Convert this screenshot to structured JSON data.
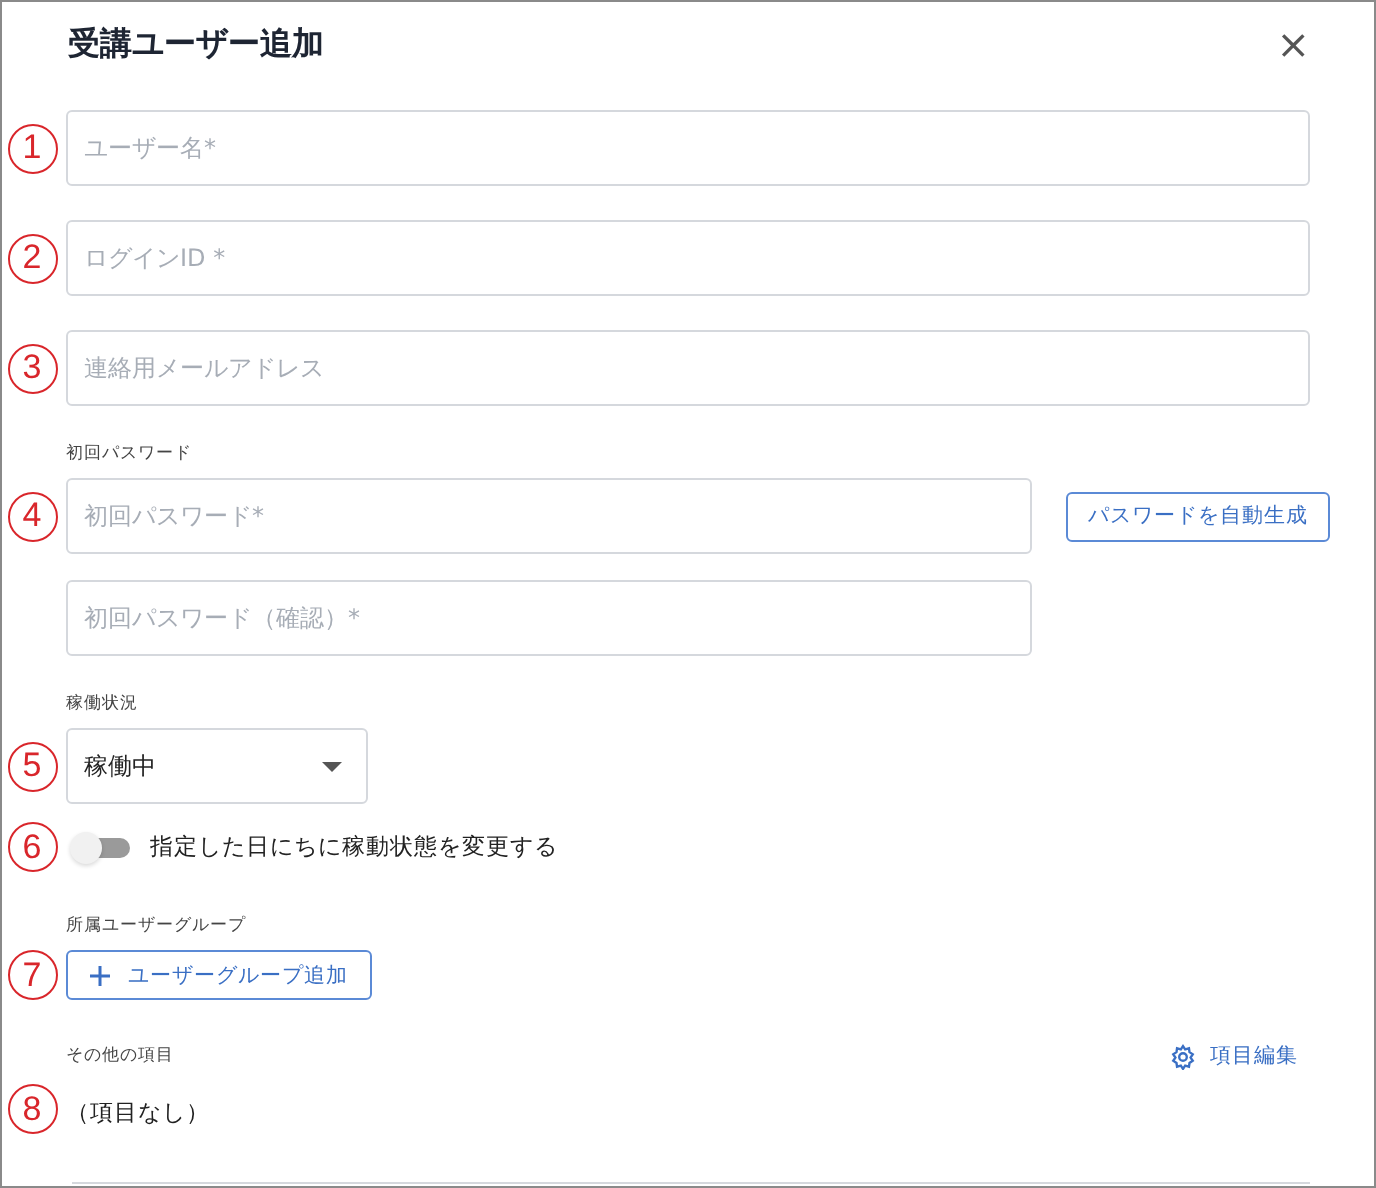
{
  "dialog": {
    "title": "受講ユーザー追加",
    "close": "×"
  },
  "rows": [
    {
      "kind": "field",
      "marker": "1",
      "placeholder": "ユーザー名*"
    },
    {
      "kind": "field",
      "marker": "2",
      "placeholder": "ログインID *"
    },
    {
      "kind": "field",
      "marker": "3",
      "placeholder": "連絡用メールアドレス"
    },
    {
      "kind": "label",
      "text": "初回パスワード"
    },
    {
      "kind": "password",
      "marker": "4",
      "placeholder": "初回パスワード*",
      "button": "パスワードを自動生成"
    },
    {
      "kind": "password",
      "placeholder": "初回パスワード（確認）*"
    },
    {
      "kind": "label",
      "text": "稼働状況"
    },
    {
      "kind": "select",
      "marker": "5",
      "value": "稼働中"
    },
    {
      "kind": "toggle",
      "marker": "6",
      "label": "指定した日にちに稼動状態を変更する",
      "on": false
    },
    {
      "kind": "label",
      "text": "所属ユーザーグループ"
    },
    {
      "kind": "add",
      "marker": "7",
      "label": "ユーザーグループ追加"
    },
    {
      "kind": "section",
      "text": "その他の項目",
      "link": "項目編集"
    },
    {
      "kind": "note",
      "marker": "8",
      "text": "（項目なし）"
    }
  ]
}
